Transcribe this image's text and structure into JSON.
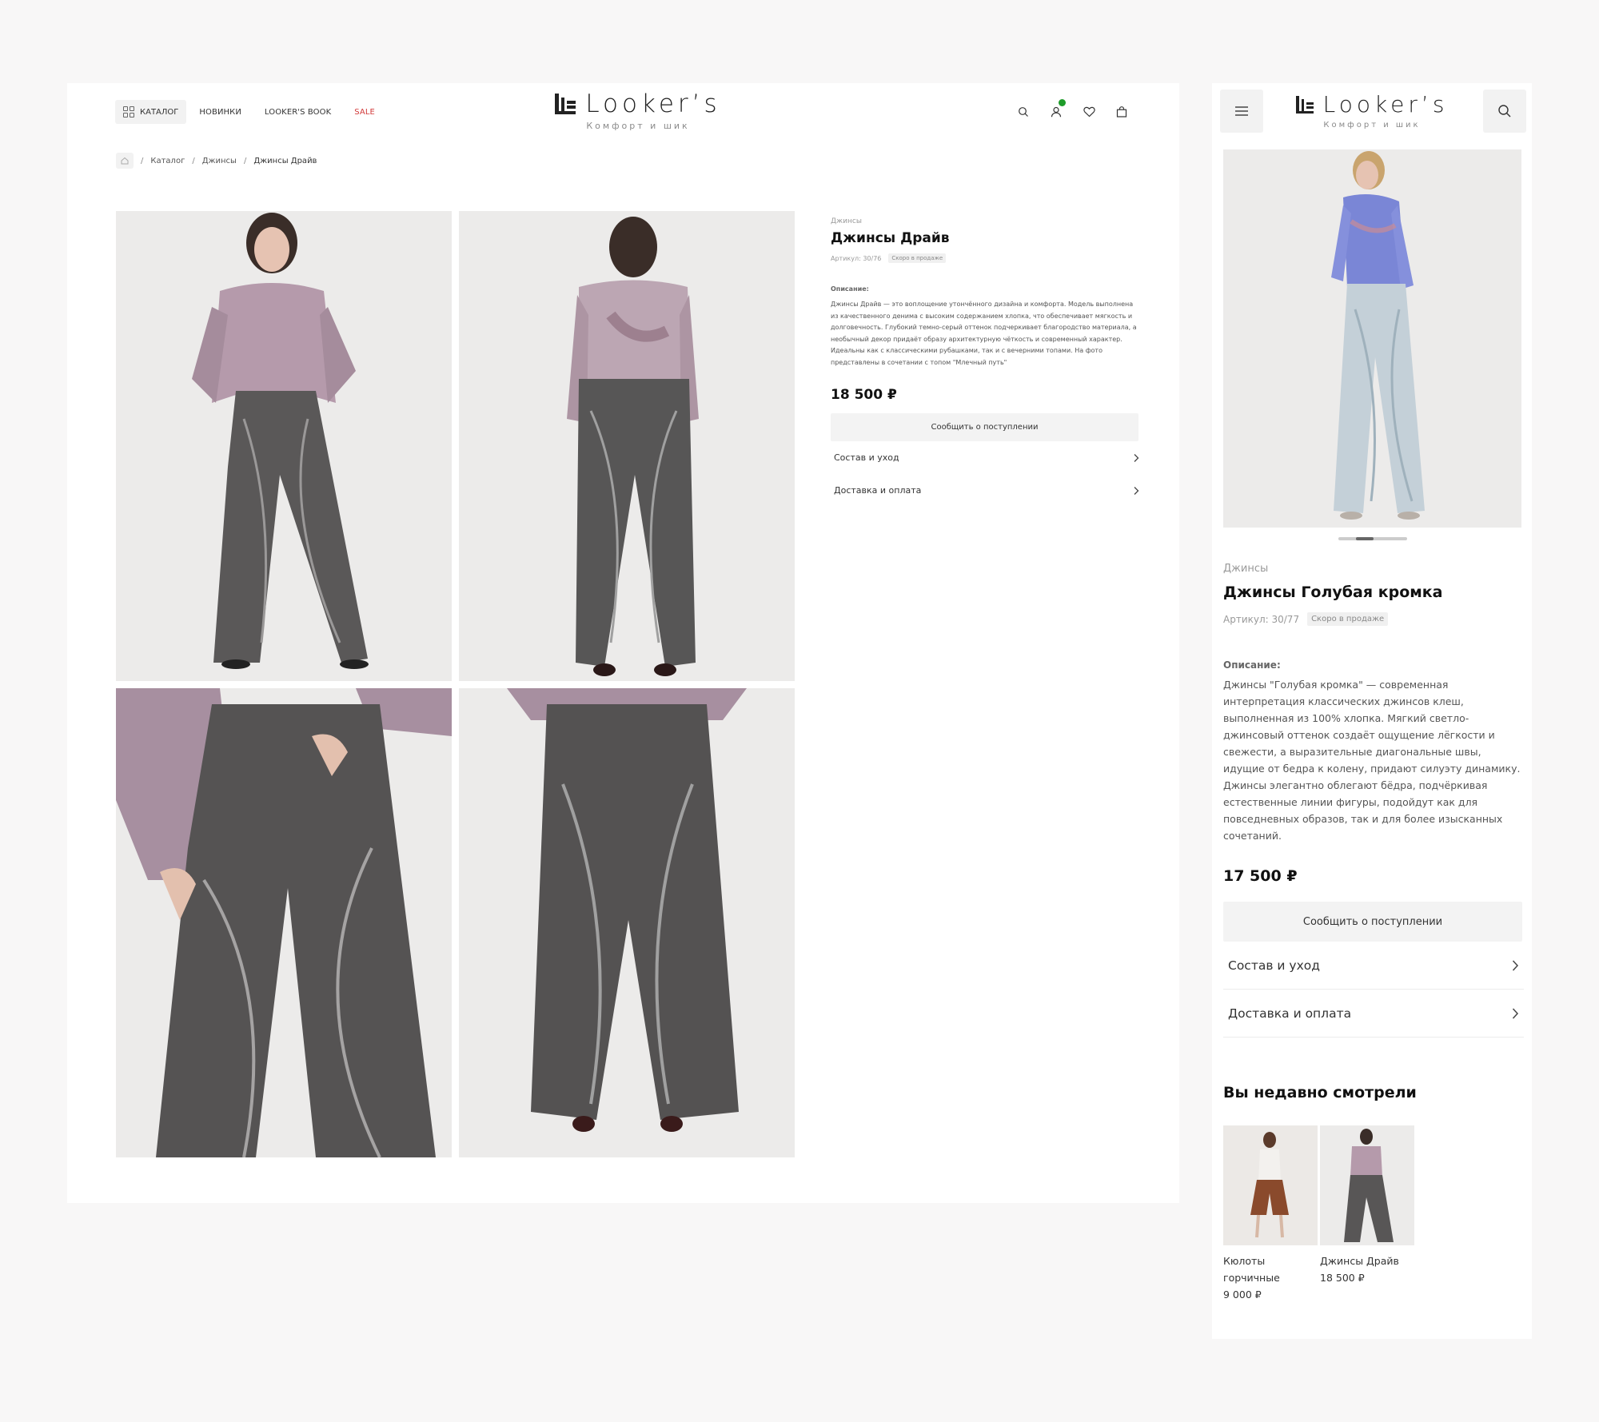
{
  "brand": {
    "name": "Looker’s",
    "tagline": "Комфорт и шик"
  },
  "desktop": {
    "nav": {
      "catalog": "КАТАЛОГ",
      "new": "НОВИНКИ",
      "book": "LOOKER'S BOOK",
      "sale": "SALE"
    },
    "breadcrumb": {
      "sep": "/",
      "catalog": "Каталог",
      "category": "Джинсы",
      "current": "Джинсы Драйв"
    },
    "product": {
      "category": "Джинсы",
      "title": "Джинсы Драйв",
      "sku": "Артикул: 30/76",
      "badge": "Скоро в продаже",
      "description_label": "Описание:",
      "description": "Джинсы Драйв — это воплощение утончённого дизайна и комфорта. Модель выполнена из качественного денима с высоким содержанием хлопка, что обеспечивает мягкость и долговечность. Глубокий темно-серый оттенок подчеркивает благородство материала, а необычный декор придаёт образу архитектурную чёткость и современный характер.  Идеальны как с классическими рубашками, так и с вечерними топами. На фото представлены в сочетании с топом \"Млечный путь\"",
      "price": "18 500 ₽",
      "notify_button": "Сообщить о поступлении",
      "accordion": [
        {
          "label": "Состав и уход"
        },
        {
          "label": "Доставка и оплата"
        }
      ]
    },
    "icons": [
      "search-icon",
      "user-icon",
      "heart-icon",
      "bag-icon"
    ],
    "notification_color": "#1e9c2a",
    "sale_color": "#d23b3b"
  },
  "mobile": {
    "product": {
      "category": "Джинсы",
      "title": "Джинсы Голубая кромка",
      "sku": "Артикул: 30/77",
      "badge": "Скоро в продаже",
      "description_label": "Описание:",
      "description": "Джинсы \"Голубая кромка\" — современная интерпретация классических джинсов клеш, выполненная из 100% хлопка. Мягкий светло-джинсовый оттенок создаёт ощущение лёгкости и свежести, а выразительные диагональные швы, идущие от бедра к колену, придают силуэту динамику. Джинсы элегантно облегают бёдра, подчёркивая естественные линии фигуры, подойдут как для повседневных образов, так и для более изысканных сочетаний.",
      "price": "17 500 ₽",
      "notify_button": "Сообщить о поступлении",
      "accordion": [
        {
          "label": "Состав и уход"
        },
        {
          "label": "Доставка и оплата"
        }
      ],
      "gallery_active_index": 1,
      "gallery_count": 4
    },
    "recently_viewed": {
      "title": "Вы недавно смотрели",
      "items": [
        {
          "name": "Кюлоты горчичные",
          "price": "9 000 ₽"
        },
        {
          "name": "Джинсы Драйв",
          "price": "18 500 ₽"
        }
      ]
    },
    "icons": [
      "menu-icon",
      "search-icon"
    ]
  }
}
